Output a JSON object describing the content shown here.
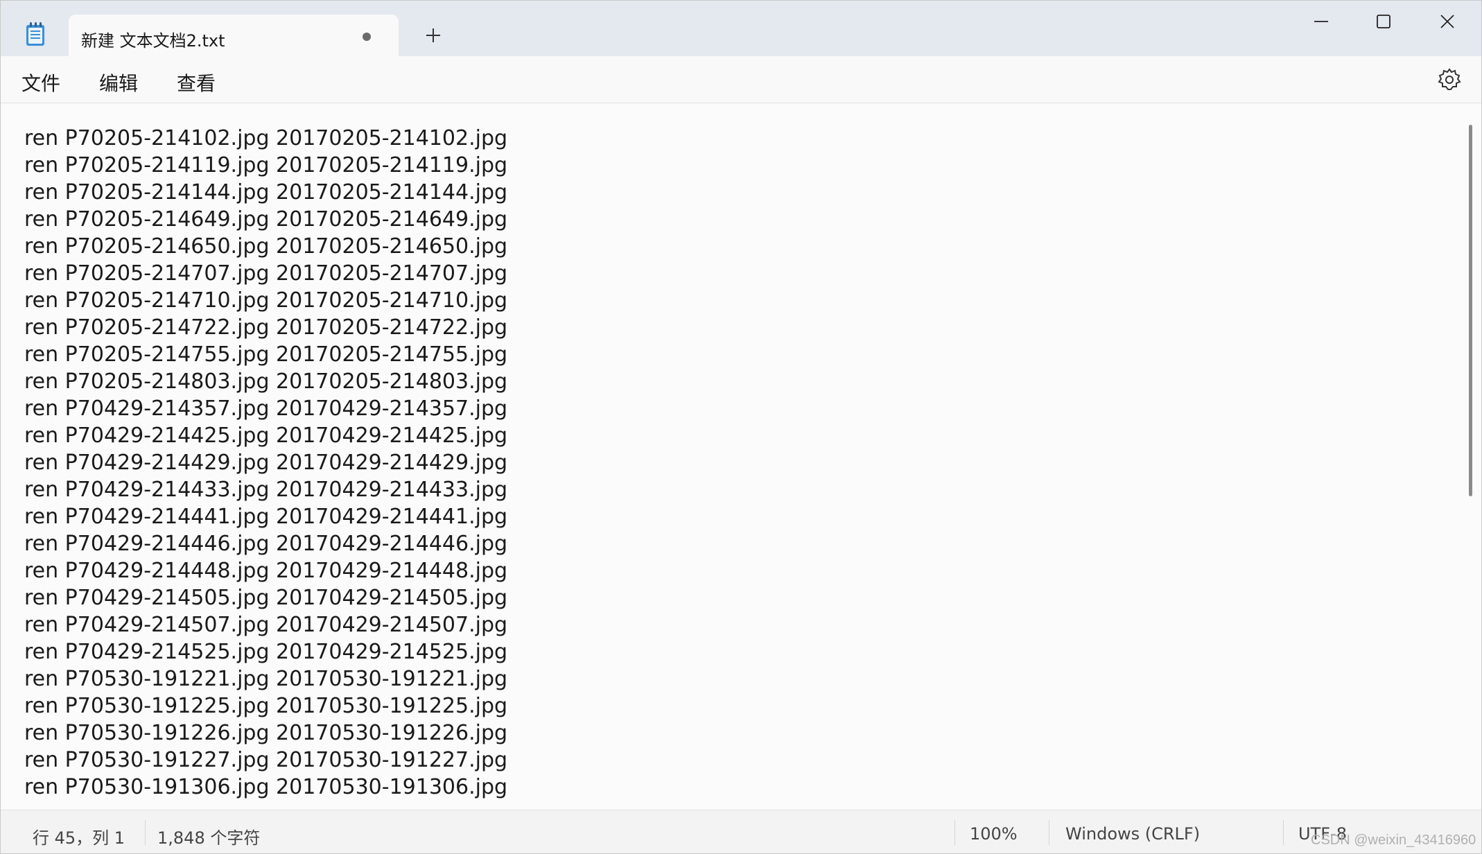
{
  "tab": {
    "title": "新建 文本文档2.txt"
  },
  "menu": {
    "file": "文件",
    "edit": "编辑",
    "view": "查看"
  },
  "icons": {
    "app": "notepad-icon",
    "unsaved": "unsaved-dot-icon",
    "new_tab": "plus-icon",
    "minimize": "minimize-icon",
    "maximize": "maximize-icon",
    "close": "close-icon",
    "settings": "gear-icon"
  },
  "editor": {
    "lines": [
      "ren P70205-214102.jpg 20170205-214102.jpg",
      "ren P70205-214119.jpg 20170205-214119.jpg",
      "ren P70205-214144.jpg 20170205-214144.jpg",
      "ren P70205-214649.jpg 20170205-214649.jpg",
      "ren P70205-214650.jpg 20170205-214650.jpg",
      "ren P70205-214707.jpg 20170205-214707.jpg",
      "ren P70205-214710.jpg 20170205-214710.jpg",
      "ren P70205-214722.jpg 20170205-214722.jpg",
      "ren P70205-214755.jpg 20170205-214755.jpg",
      "ren P70205-214803.jpg 20170205-214803.jpg",
      "ren P70429-214357.jpg 20170429-214357.jpg",
      "ren P70429-214425.jpg 20170429-214425.jpg",
      "ren P70429-214429.jpg 20170429-214429.jpg",
      "ren P70429-214433.jpg 20170429-214433.jpg",
      "ren P70429-214441.jpg 20170429-214441.jpg",
      "ren P70429-214446.jpg 20170429-214446.jpg",
      "ren P70429-214448.jpg 20170429-214448.jpg",
      "ren P70429-214505.jpg 20170429-214505.jpg",
      "ren P70429-214507.jpg 20170429-214507.jpg",
      "ren P70429-214525.jpg 20170429-214525.jpg",
      "ren P70530-191221.jpg 20170530-191221.jpg",
      "ren P70530-191225.jpg 20170530-191225.jpg",
      "ren P70530-191226.jpg 20170530-191226.jpg",
      "ren P70530-191227.jpg 20170530-191227.jpg",
      "ren P70530-191306.jpg 20170530-191306.jpg"
    ]
  },
  "status": {
    "position": "行 45，列 1",
    "char_count": "1,848 个字符",
    "zoom": "100%",
    "line_ending": "Windows (CRLF)",
    "encoding": "UTF-8"
  },
  "watermark": "CSDN @weixin_43416960",
  "colors": {
    "titlebar": "#e4e8ef",
    "editor_bg": "#fbfbfb",
    "text": "#1a1a1a"
  }
}
